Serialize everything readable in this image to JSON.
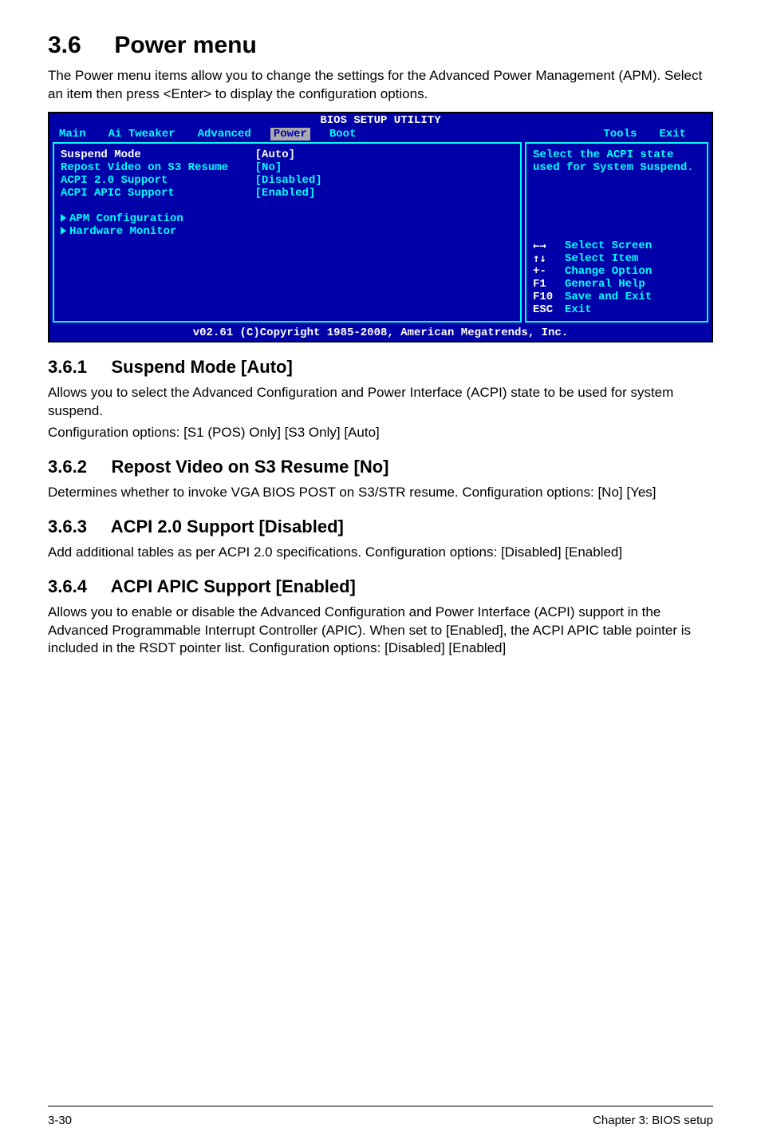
{
  "title_num": "3.6",
  "title_text": "Power menu",
  "intro": "The Power menu items allow you to change the settings for the Advanced Power Management (APM). Select an item then press <Enter> to display the configuration options.",
  "bios": {
    "header": "BIOS SETUP UTILITY",
    "tabs": [
      "Main",
      "Ai Tweaker",
      "Advanced",
      "Power",
      "Boot",
      "Tools",
      "Exit"
    ],
    "selected_tab": "Power",
    "left_items": [
      {
        "label": "Suspend Mode",
        "value": "[Auto]",
        "selected": true
      },
      {
        "label": "Repost Video on S3 Resume",
        "value": "[No]"
      },
      {
        "label": "ACPI 2.0 Support",
        "value": "[Disabled]"
      },
      {
        "label": "ACPI APIC Support",
        "value": "[Enabled]"
      }
    ],
    "sub_items": [
      "APM Configuration",
      "Hardware Monitor"
    ],
    "help_text": "Select the ACPI state used for System Suspend.",
    "nav": [
      {
        "sym": "←→",
        "label": "Select Screen"
      },
      {
        "sym": "↑↓",
        "label": "Select Item"
      },
      {
        "sym": "+-",
        "label": "Change Option"
      },
      {
        "sym": "F1",
        "label": "General Help"
      },
      {
        "sym": "F10",
        "label": "Save and Exit"
      },
      {
        "sym": "ESC",
        "label": "Exit"
      }
    ],
    "footer": "v02.61 (C)Copyright 1985-2008, American Megatrends, Inc."
  },
  "sections": [
    {
      "num": "3.6.1",
      "heading": "Suspend Mode [Auto]",
      "paras": [
        "Allows you to select the Advanced Configuration and Power Interface (ACPI) state to be used for system suspend.",
        "Configuration options: [S1 (POS) Only] [S3 Only] [Auto]"
      ]
    },
    {
      "num": "3.6.2",
      "heading": "Repost Video on S3 Resume [No]",
      "paras": [
        "Determines whether to invoke VGA BIOS POST on S3/STR resume. Configuration options: [No] [Yes]"
      ]
    },
    {
      "num": "3.6.3",
      "heading": "ACPI 2.0 Support [Disabled]",
      "paras": [
        "Add additional tables as per ACPI 2.0 specifications. Configuration options: [Disabled] [Enabled]"
      ]
    },
    {
      "num": "3.6.4",
      "heading": "ACPI APIC Support [Enabled]",
      "paras": [
        "Allows you to enable or disable the Advanced Configuration and Power Interface (ACPI) support in the Advanced Programmable Interrupt Controller (APIC). When set to [Enabled], the ACPI APIC table pointer is included in the RSDT pointer list. Configuration options: [Disabled] [Enabled]"
      ]
    }
  ],
  "page_footer_left": "3-30",
  "page_footer_right": "Chapter 3: BIOS setup"
}
